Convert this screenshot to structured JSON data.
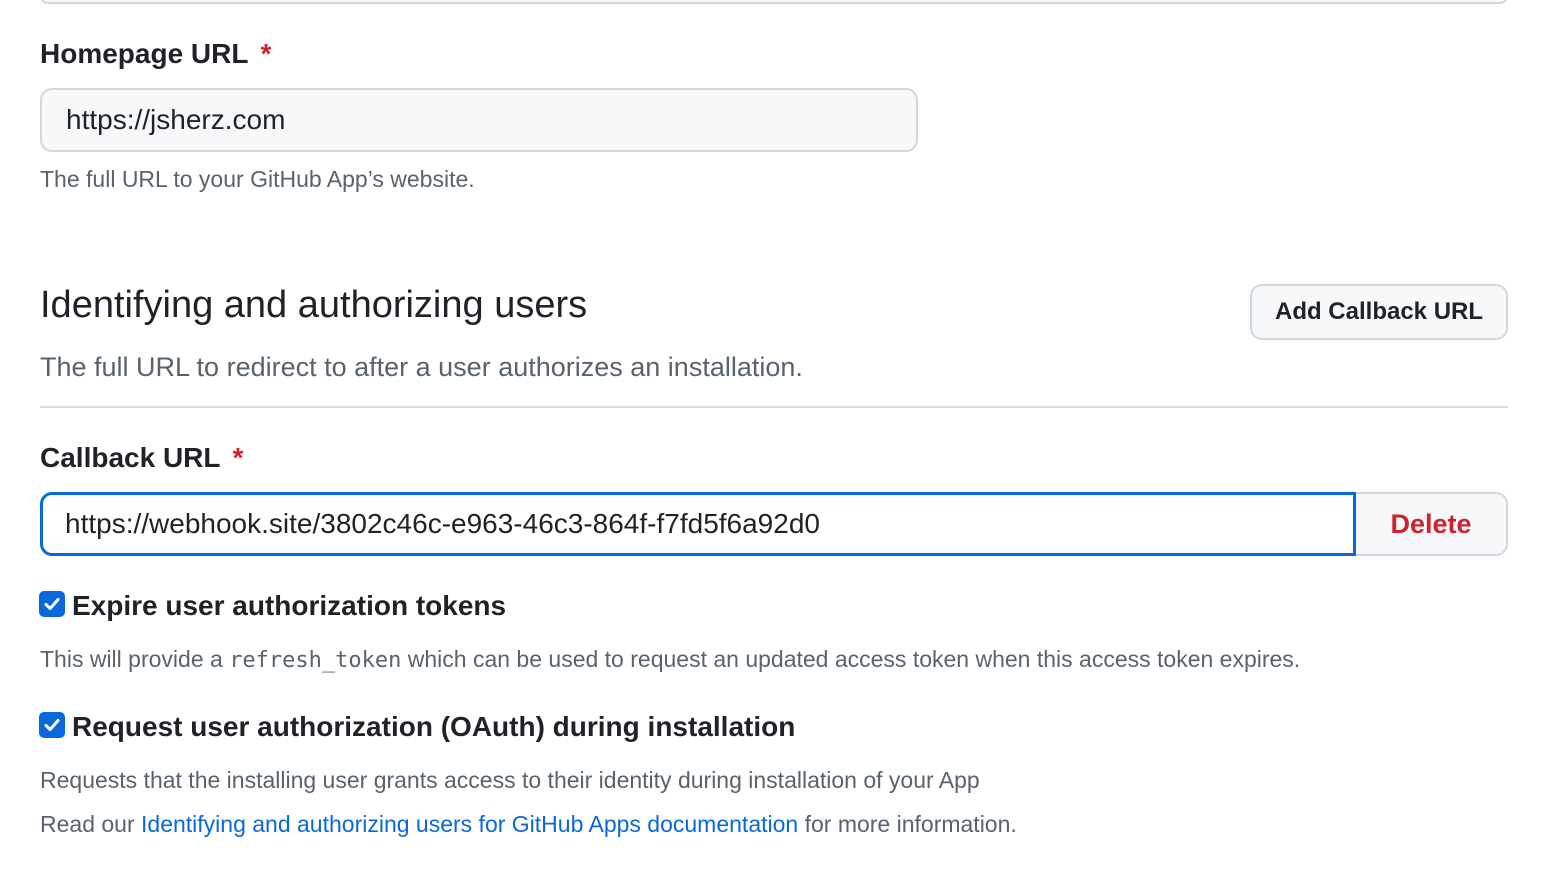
{
  "homepage": {
    "label": "Homepage URL",
    "required_mark": "*",
    "value": "https://jsherz.com",
    "note": "The full URL to your GitHub App’s website."
  },
  "identifying": {
    "title": "Identifying and authorizing users",
    "description": "The full URL to redirect to after a user authorizes an installation.",
    "add_callback_label": "Add Callback URL"
  },
  "callback": {
    "label": "Callback URL",
    "required_mark": "*",
    "value": "https://webhook.site/3802c46c-e963-46c3-864f-f7fd5f6a92d0",
    "delete_label": "Delete"
  },
  "expire_tokens": {
    "checked": true,
    "label": "Expire user authorization tokens",
    "desc_before": "This will provide a ",
    "desc_code": "refresh_token",
    "desc_after": " which can be used to request an updated access token when this access token expires."
  },
  "request_oauth": {
    "checked": true,
    "label": "Request user authorization (OAuth) during installation",
    "desc": "Requests that the installing user grants access to their identity during installation of your App",
    "read_before": "Read our ",
    "read_link": "Identifying and authorizing users for GitHub Apps documentation",
    "read_after": " for more information."
  },
  "colors": {
    "accent": "#0969da",
    "danger": "#cf222e",
    "muted_text": "#59636e"
  }
}
